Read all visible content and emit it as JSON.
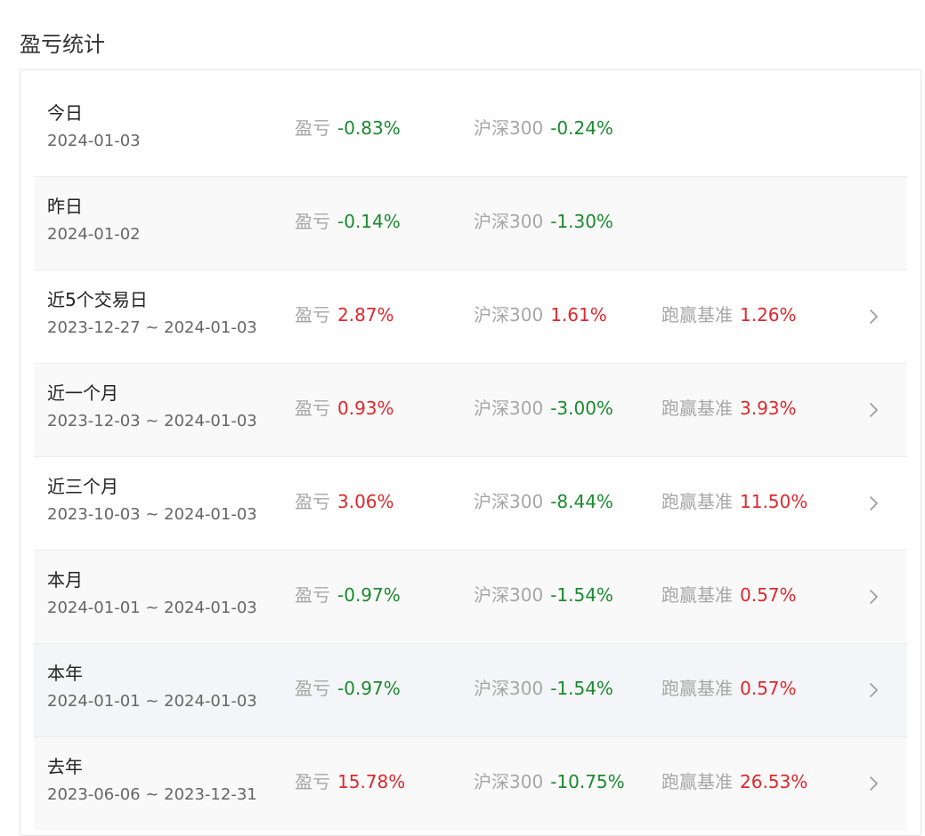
{
  "page": {
    "title": "盈亏统计"
  },
  "labels": {
    "pnl": "盈亏",
    "benchmark": "沪深300",
    "beat": "跑赢基准"
  },
  "colors": {
    "up": "#e0282c",
    "down": "#1a8a2e",
    "label": "#a6a6a6"
  },
  "rows": [
    {
      "name": "今日",
      "range": "2024-01-03",
      "pnl": "-0.83%",
      "bench": "-0.24%",
      "beat": "",
      "chevron": false
    },
    {
      "name": "昨日",
      "range": "2024-01-02",
      "pnl": "-0.14%",
      "bench": "-1.30%",
      "beat": "",
      "chevron": false
    },
    {
      "name": "近5个交易日",
      "range": "2023-12-27 ~ 2024-01-03",
      "pnl": "2.87%",
      "bench": "1.61%",
      "beat": "1.26%",
      "chevron": true
    },
    {
      "name": "近一个月",
      "range": "2023-12-03 ~ 2024-01-03",
      "pnl": "0.93%",
      "bench": "-3.00%",
      "beat": "3.93%",
      "chevron": true
    },
    {
      "name": "近三个月",
      "range": "2023-10-03 ~ 2024-01-03",
      "pnl": "3.06%",
      "bench": "-8.44%",
      "beat": "11.50%",
      "chevron": true
    },
    {
      "name": "本月",
      "range": "2024-01-01 ~ 2024-01-03",
      "pnl": "-0.97%",
      "bench": "-1.54%",
      "beat": "0.57%",
      "chevron": true
    },
    {
      "name": "本年",
      "range": "2024-01-01 ~ 2024-01-03",
      "pnl": "-0.97%",
      "bench": "-1.54%",
      "beat": "0.57%",
      "chevron": true
    },
    {
      "name": "去年",
      "range": "2023-06-06 ~ 2023-12-31",
      "pnl": "15.78%",
      "bench": "-10.75%",
      "beat": "26.53%",
      "chevron": true
    }
  ]
}
